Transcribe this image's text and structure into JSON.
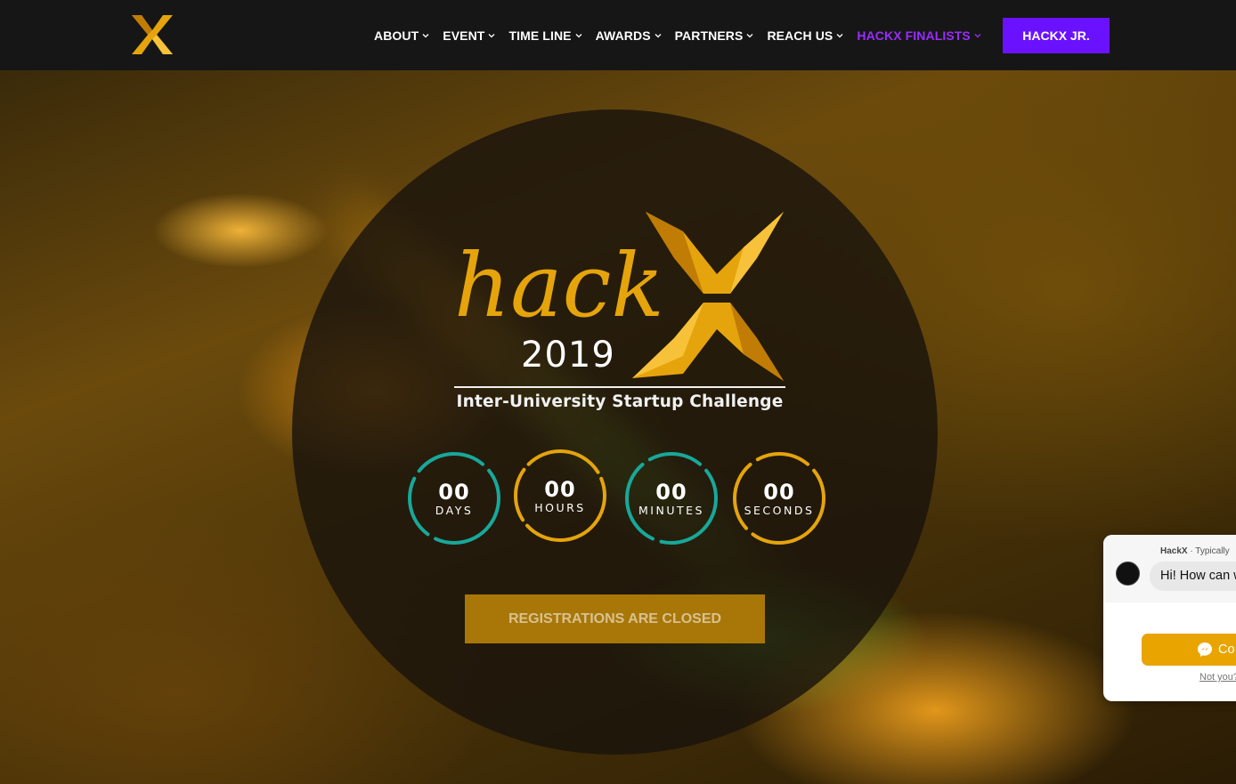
{
  "nav": {
    "items": [
      {
        "label": "ABOUT"
      },
      {
        "label": "EVENT"
      },
      {
        "label": "TIME LINE"
      },
      {
        "label": "AWARDS"
      },
      {
        "label": "PARTNERS"
      },
      {
        "label": "REACH US"
      },
      {
        "label": "HACKX FINALISTS"
      }
    ],
    "cta_label": "HACKX JR."
  },
  "hero": {
    "wordmark": "hack",
    "year": "2019",
    "tagline": "Inter-University Startup Challenge",
    "countdown": [
      {
        "value": "00",
        "unit": "DAYS"
      },
      {
        "value": "00",
        "unit": "HOURS"
      },
      {
        "value": "00",
        "unit": "MINUTES"
      },
      {
        "value": "00",
        "unit": "SECONDS"
      }
    ],
    "register_label": "REGISTRATIONS ARE CLOSED"
  },
  "chat": {
    "page_name": "HackX",
    "status": "Typically",
    "greeting": "Hi! How can w",
    "continue_label": "Co",
    "not_you": "Not you?"
  },
  "colors": {
    "header_bg": "#161616",
    "accent_purple": "#6a12ff",
    "active_nav": "#9a2cff",
    "gold": "#e5a40c",
    "teal": "#18a89a"
  }
}
